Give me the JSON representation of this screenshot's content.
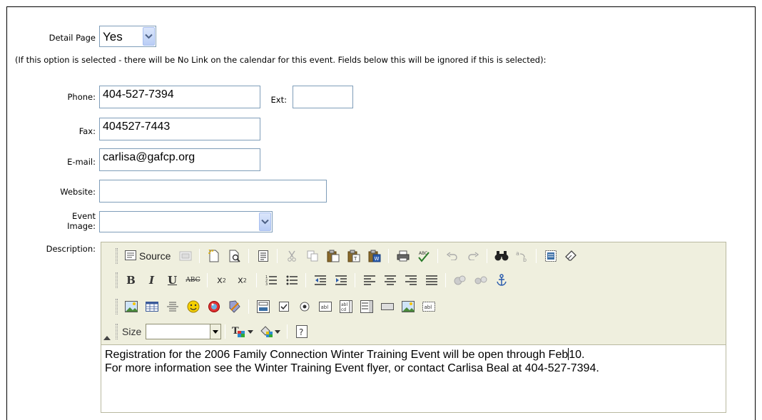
{
  "form": {
    "detail_page": {
      "label": "Detail Page",
      "value": "Yes"
    },
    "note": "(If this option is selected - there will be No Link on the calendar for this event. Fields below this will be ignored if this is selected):",
    "phone": {
      "label": "Phone:",
      "value": "404-527-7394"
    },
    "ext": {
      "label": "Ext:",
      "value": ""
    },
    "fax": {
      "label": "Fax:",
      "value": "404527-7443"
    },
    "email": {
      "label": "E-mail:",
      "value": "carlisa@gafcp.org"
    },
    "website": {
      "label": "Website:",
      "value": ""
    },
    "event_image": {
      "label_line1": "Event",
      "label_line2": "Image:",
      "value": ""
    },
    "description": {
      "label": "Description:"
    }
  },
  "editor": {
    "source_label": "Source",
    "size_label": "Size",
    "size_value": "",
    "content_line1_pre": "Registration for the 2006 Family Connection Winter Training Event will be open through Feb",
    "content_line1_post": "10.",
    "content_line2": "For more information see the Winter Training Event flyer, or contact Carlisa Beal at 404-527-7394.",
    "toolbar_row1": [
      "source-button",
      "preview-icon",
      "new-page-icon",
      "print-preview-icon",
      "templates-icon",
      "cut-icon",
      "copy-icon",
      "paste-icon",
      "paste-text-icon",
      "paste-word-icon",
      "print-icon",
      "spellcheck-icon",
      "undo-icon",
      "redo-icon",
      "find-icon",
      "replace-icon",
      "select-all-icon",
      "remove-format-icon"
    ],
    "toolbar_row2": [
      "bold-icon",
      "italic-icon",
      "underline-icon",
      "strike-icon",
      "subscript-icon",
      "superscript-icon",
      "ordered-list-icon",
      "unordered-list-icon",
      "outdent-icon",
      "indent-icon",
      "align-left-icon",
      "align-center-icon",
      "align-right-icon",
      "align-justify-icon",
      "link-icon",
      "unlink-icon",
      "anchor-icon"
    ],
    "toolbar_row3": [
      "image-icon",
      "table-icon",
      "horizontal-rule-icon",
      "smiley-icon",
      "special-char-icon",
      "page-break-icon",
      "form-icon",
      "checkbox-icon",
      "radio-icon",
      "text-field-icon",
      "textarea-icon",
      "select-field-icon",
      "button-icon",
      "image-button-icon",
      "hidden-field-icon"
    ]
  },
  "colors": {
    "field_border": "#7f9db9",
    "toolbar_bg": "#efefde",
    "dropdown_btn": "#b9cdf5"
  }
}
